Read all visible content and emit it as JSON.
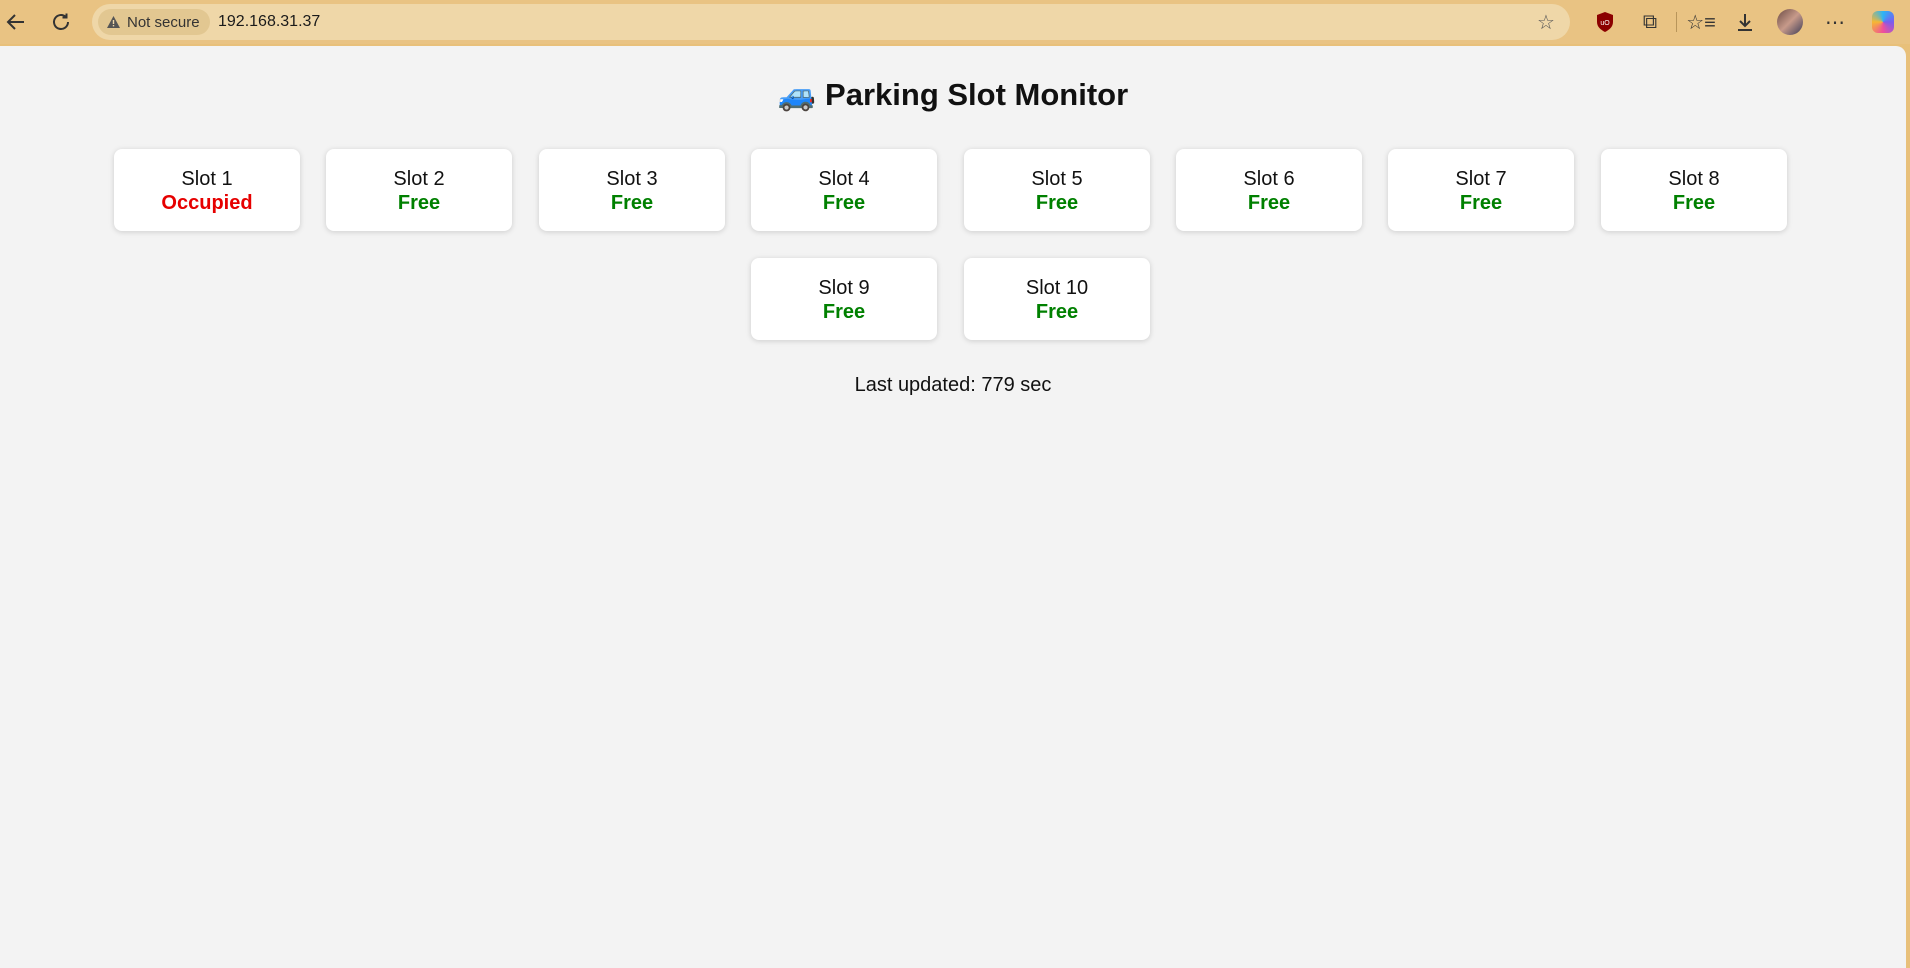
{
  "browser": {
    "security_label": "Not secure",
    "url": "192.168.31.37",
    "icons": [
      "back-arrow-icon",
      "reload-icon",
      "warning-icon",
      "star-icon",
      "ublock-icon",
      "extensions-icon",
      "favorites-icon",
      "download-icon",
      "avatar",
      "more-icon",
      "copilot-icon"
    ]
  },
  "page": {
    "title_emoji": "🚙",
    "title": "Parking Slot Monitor",
    "slots": [
      {
        "name": "Slot 1",
        "status": "Occupied"
      },
      {
        "name": "Slot 2",
        "status": "Free"
      },
      {
        "name": "Slot 3",
        "status": "Free"
      },
      {
        "name": "Slot 4",
        "status": "Free"
      },
      {
        "name": "Slot 5",
        "status": "Free"
      },
      {
        "name": "Slot 6",
        "status": "Free"
      },
      {
        "name": "Slot 7",
        "status": "Free"
      },
      {
        "name": "Slot 8",
        "status": "Free"
      },
      {
        "name": "Slot 9",
        "status": "Free"
      },
      {
        "name": "Slot 10",
        "status": "Free"
      }
    ],
    "last_updated": "Last updated: 779 sec"
  },
  "colors": {
    "occupied": "#e60000",
    "free": "#008000",
    "chrome": "#e9c383",
    "page_bg": "#f3f3f3"
  }
}
